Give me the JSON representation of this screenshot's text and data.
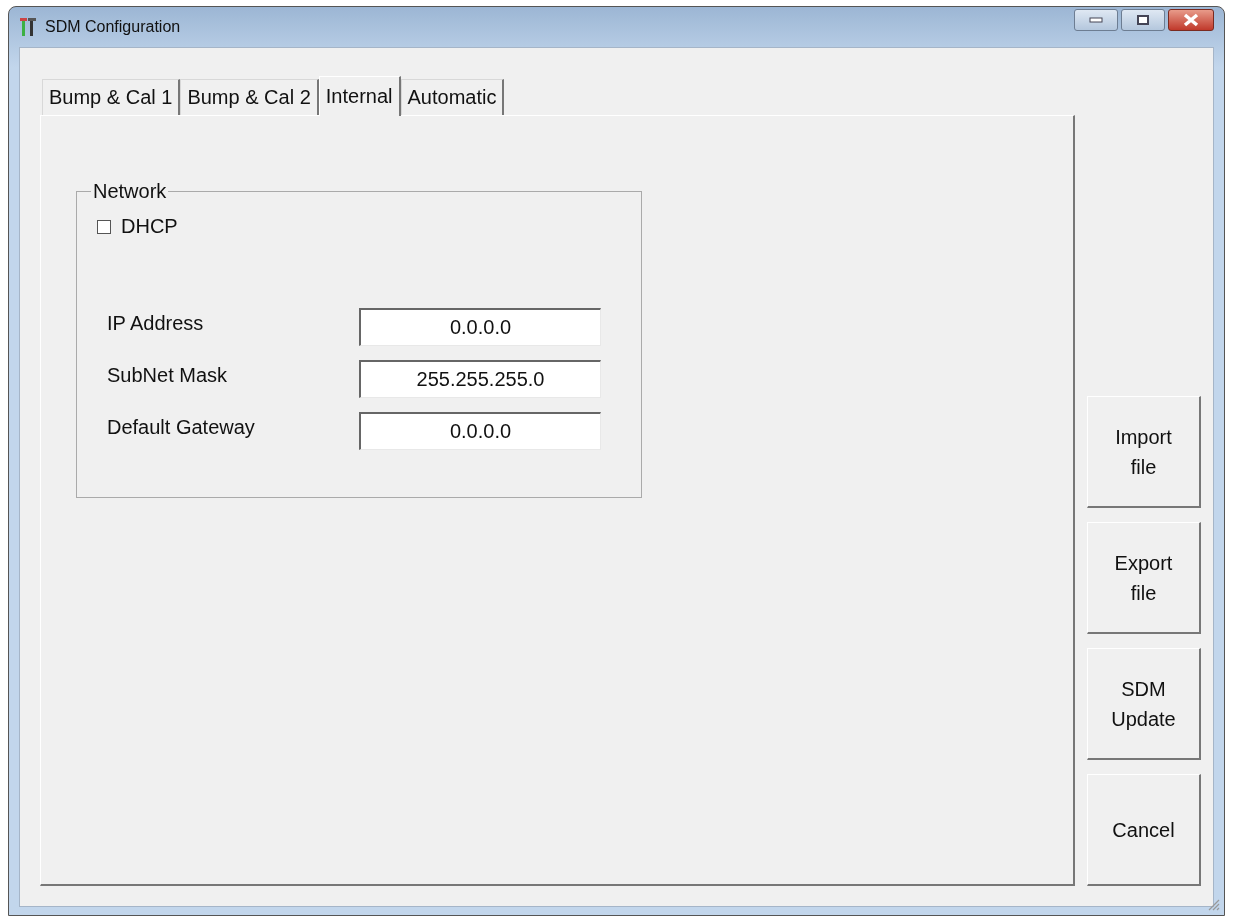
{
  "window": {
    "title": "SDM Configuration"
  },
  "tabs": [
    {
      "label": "Bump & Cal 1",
      "selected": false
    },
    {
      "label": "Bump & Cal 2",
      "selected": false
    },
    {
      "label": "Internal",
      "selected": true
    },
    {
      "label": "Automatic",
      "selected": false
    }
  ],
  "network": {
    "title": "Network",
    "dhcp": {
      "label": "DHCP",
      "checked": false
    },
    "fields": [
      {
        "label": "IP Address",
        "value": "0.0.0.0"
      },
      {
        "label": "SubNet Mask",
        "value": "255.255.255.0"
      },
      {
        "label": "Default Gateway",
        "value": "0.0.0.0"
      }
    ]
  },
  "buttons": [
    "Import file",
    "Export file",
    "SDM Update",
    "Cancel"
  ]
}
